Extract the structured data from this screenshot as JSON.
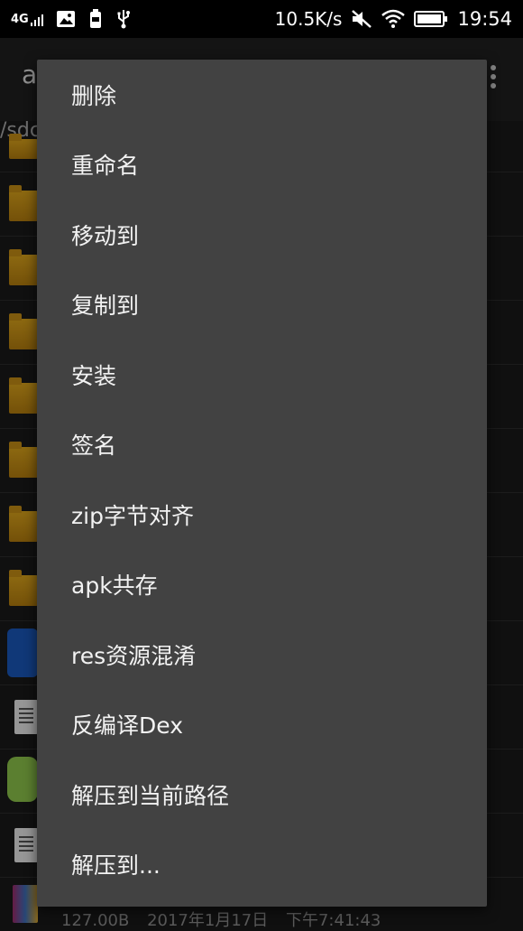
{
  "statusbar": {
    "network": "4G",
    "speed": "10.5K/s",
    "time": "19:54",
    "icons": [
      "signal-icon",
      "image-icon",
      "battery-saver-icon",
      "usb-icon",
      "mute-icon",
      "wifi-icon",
      "battery-icon"
    ]
  },
  "toolbar": {
    "title_partial": "a",
    "overflow_icon": "more-vert-icon"
  },
  "path": {
    "text_partial": "/sdc"
  },
  "file_footer": {
    "size": "127.00B",
    "date": "2017年1月17日",
    "time": "下午7:41:43"
  },
  "menu": {
    "items": [
      "删除",
      "重命名",
      "移动到",
      "复制到",
      "安装",
      "签名",
      "zip字节对齐",
      "apk共存",
      "res资源混淆",
      "反编译Dex",
      "解压到当前路径",
      "解压到..."
    ]
  }
}
